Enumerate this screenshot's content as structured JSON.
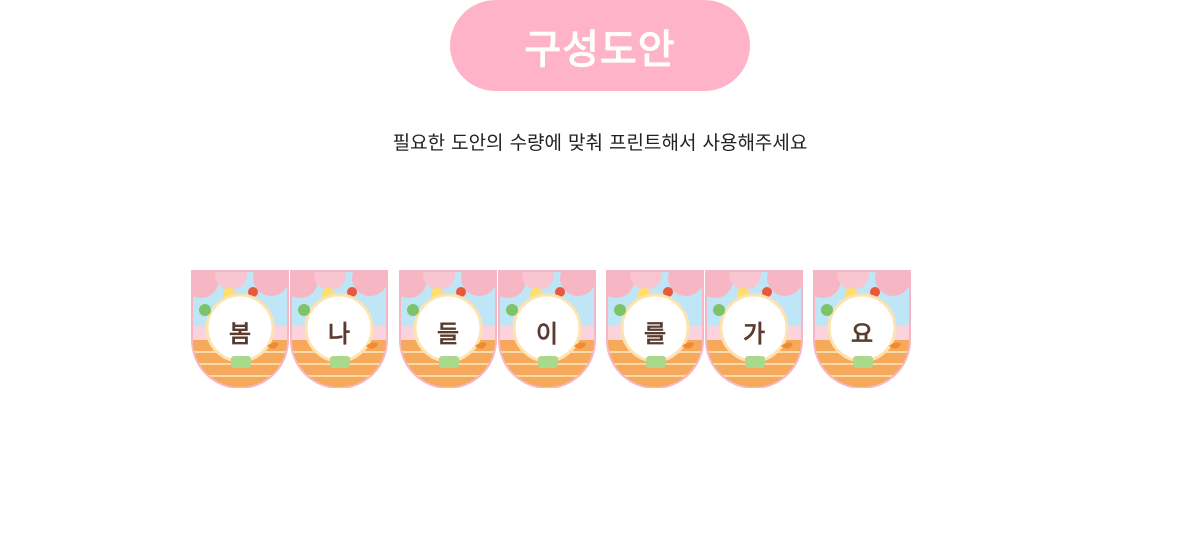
{
  "header": {
    "title": "구성도안",
    "subtitle": "필요한 도안의 수량에 맞춰 프린트해서 사용해주세요"
  },
  "banner": {
    "letters": [
      "봄",
      "나",
      "들",
      "이",
      "를",
      "가",
      "요"
    ]
  },
  "colors": {
    "pill": "#ffb3c9",
    "letter": "#5a3b2e",
    "sky": "#bfe6f7",
    "blossom": "#f7b6c4",
    "brick": "#f6a95a"
  }
}
